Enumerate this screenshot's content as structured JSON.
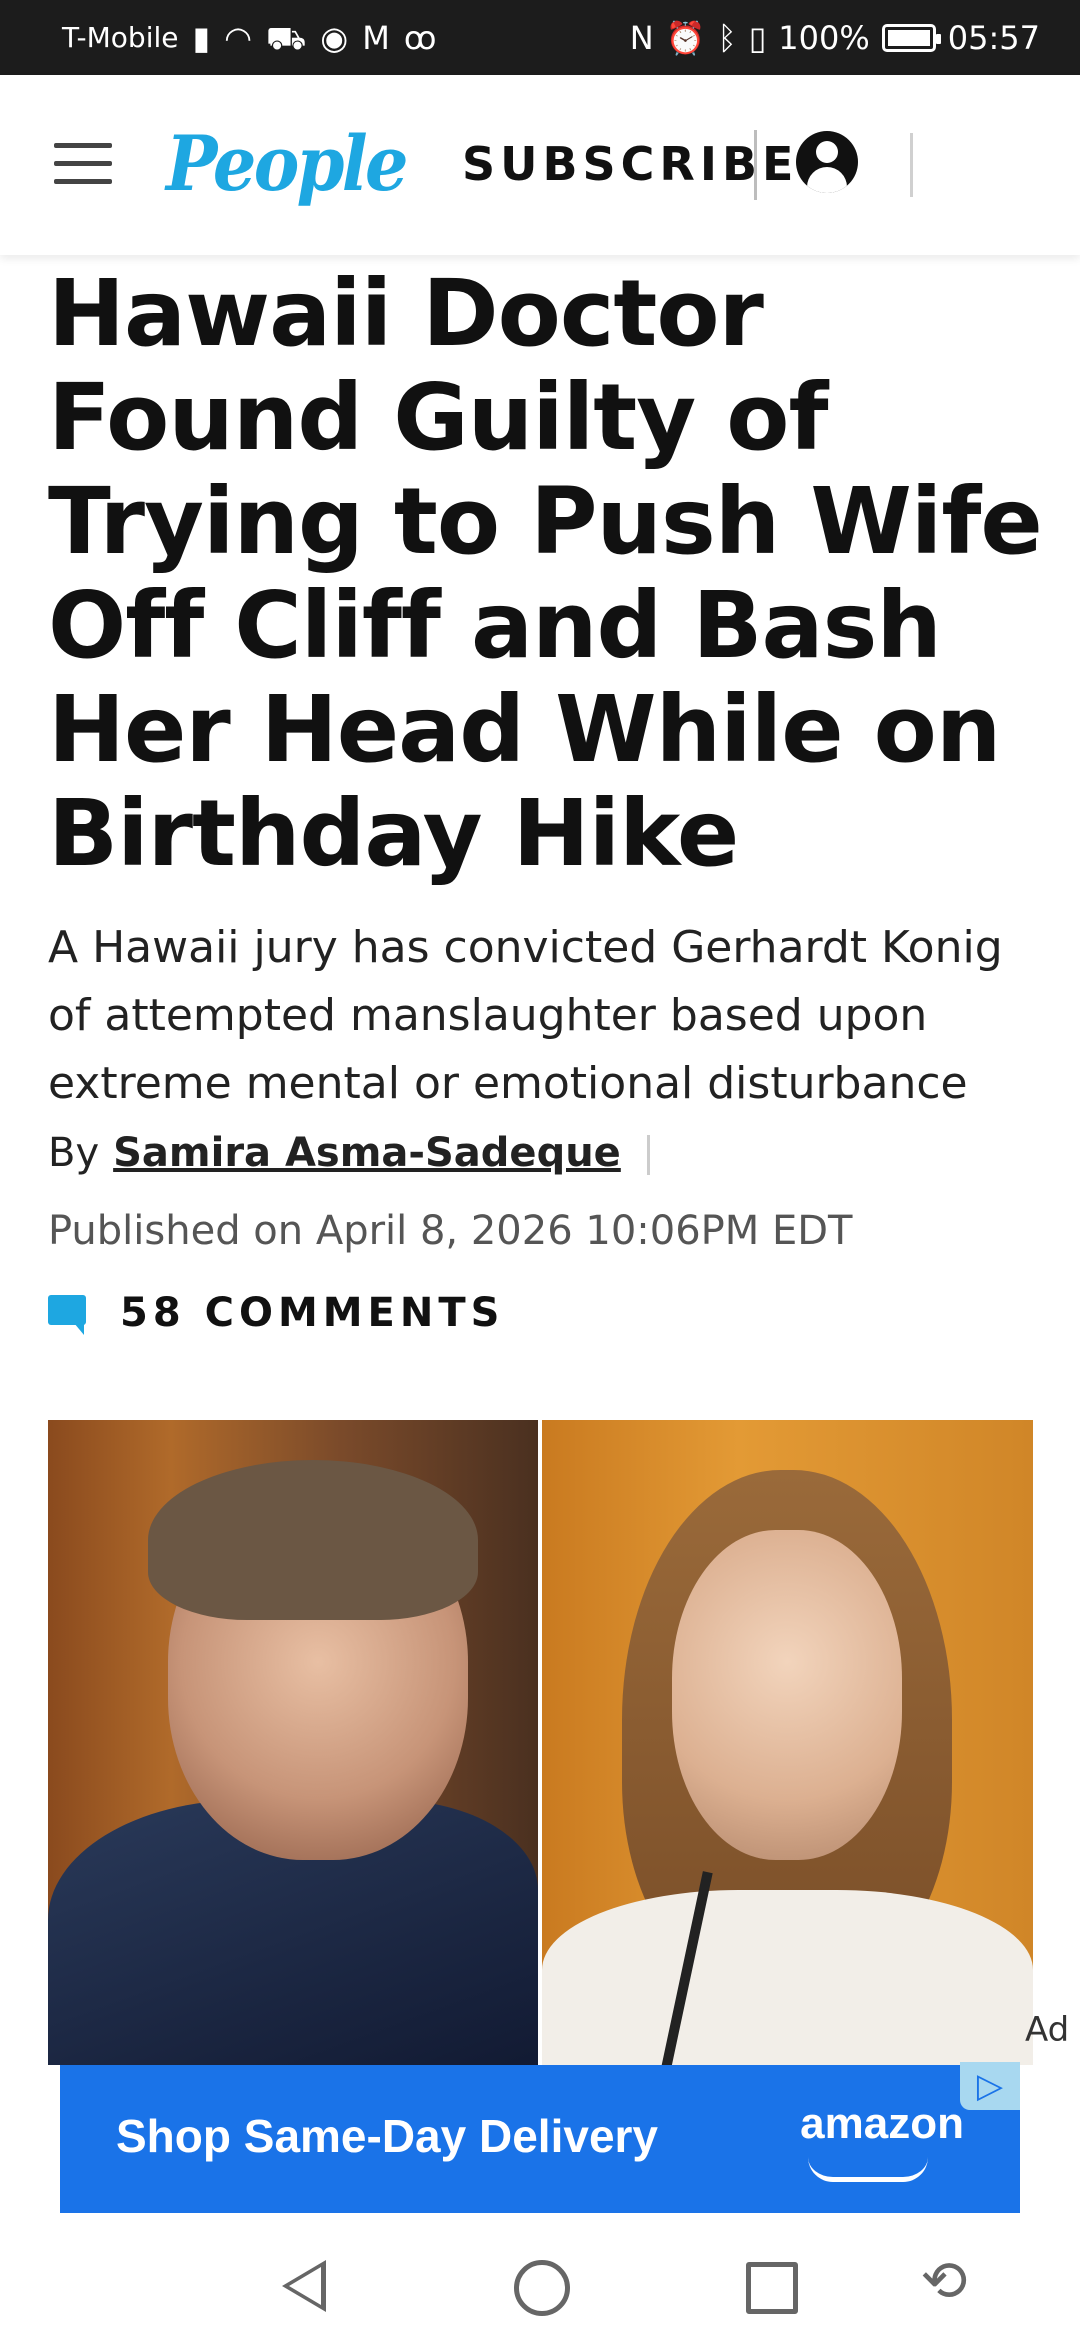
{
  "status_bar": {
    "carrier": "T-Mobile",
    "left_icons": [
      "signal-icon",
      "wifi-icon",
      "car-mode-icon",
      "eye-icon",
      "mail-icon",
      "voicemail-icon"
    ],
    "right_icons": [
      "nfc-icon",
      "alarm-icon",
      "bluetooth-icon",
      "vibrate-icon"
    ],
    "battery": "100%",
    "battery_level": 1.0,
    "time": "05:57"
  },
  "header": {
    "logo": "People",
    "subscribe_label": "SUBSCRIBE",
    "account_icon": "account-icon",
    "menu_icon": "hamburger-menu-icon"
  },
  "article": {
    "headline": "Hawaii Doctor Found Guilty of Trying to Push Wife Off Cliff and Bash Her Head While on Birthday Hike",
    "dek": "A Hawaii jury has convicted Gerhardt Konig of attempted manslaughter based upon extreme mental or emotional disturbance",
    "byline_prefix": "By",
    "author": "Samira Asma-Sadeque",
    "published": "Published on April 8, 2026 10:06PM EDT",
    "comments_label": "58 COMMENTS",
    "comment_icon": "comment-bubble-icon"
  },
  "ad": {
    "label": "Ad",
    "banner_text": "Shop Same-Day Delivery",
    "brand": "amazon",
    "choices_icon": "ad-choices-icon"
  },
  "nav_bar": {
    "icons": [
      "back-icon",
      "home-icon",
      "recents-icon",
      "rotate-icon"
    ]
  },
  "colors": {
    "brand_blue": "#1ea7e1",
    "ad_blue": "#1a73e8",
    "status_bar_bg": "#1c1c1c"
  }
}
